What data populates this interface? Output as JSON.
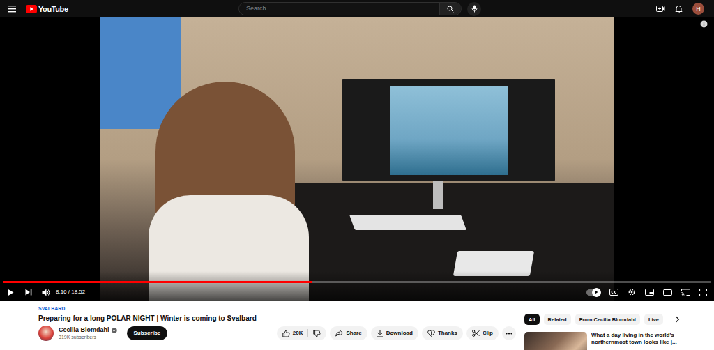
{
  "header": {
    "logo": "YouTube",
    "search": {
      "placeholder": "Search"
    },
    "avatar": "H"
  },
  "player": {
    "time": "8:16 / 18:52",
    "progress": {
      "level": 0.436
    },
    "autoplay": {
      "on": true
    }
  },
  "video": {
    "category": "SVALBARD",
    "title": "Preparing for a long POLAR NIGHT | Winter is coming to Svalbard",
    "channel": {
      "name": "Cecilia Blomdahl",
      "verified": true,
      "subscribers": "319K subscribers"
    },
    "subscribe": "Subscribe",
    "likes": "20K",
    "actions": [
      "Share",
      "Download",
      "Thanks",
      "Clip"
    ]
  },
  "chips": [
    {
      "label": "All",
      "selected": true
    },
    {
      "label": "Related",
      "selected": false
    },
    {
      "label": "From Cecilia Blomdahl",
      "selected": false
    },
    {
      "label": "Live",
      "selected": false
    }
  ],
  "recommendations": [
    {
      "title": "What a day living in the world's northernmost town looks like |..."
    }
  ]
}
